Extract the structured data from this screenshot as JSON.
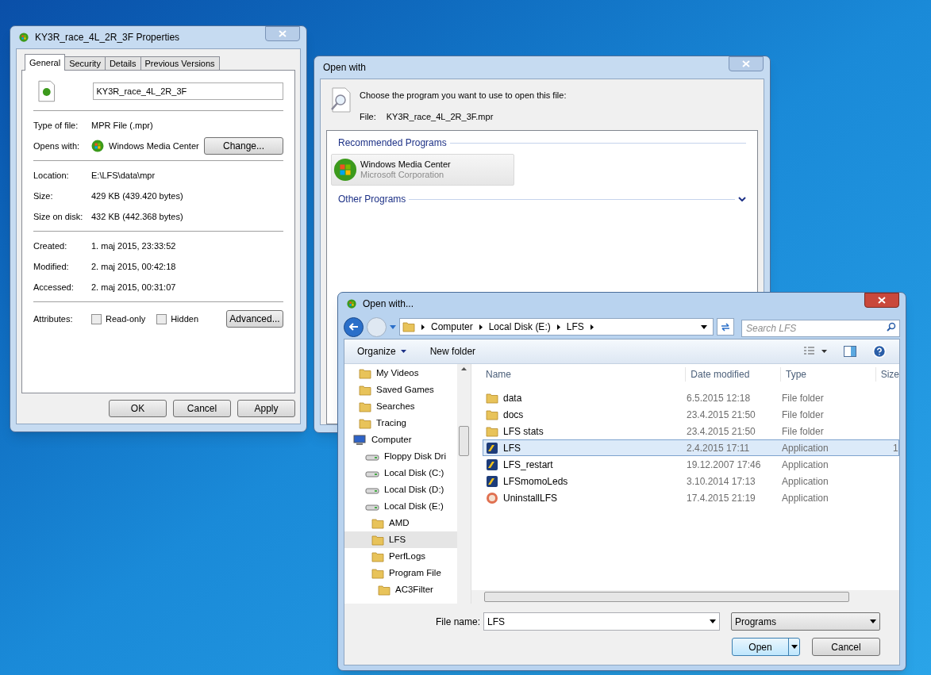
{
  "properties": {
    "title": "KY3R_race_4L_2R_3F Properties",
    "active": false,
    "tabs": [
      {
        "label": "General",
        "selected": true
      },
      {
        "label": "Security",
        "selected": false
      },
      {
        "label": "Details",
        "selected": false
      },
      {
        "label": "Previous Versions",
        "selected": false
      }
    ],
    "file_name": "KY3R_race_4L_2R_3F",
    "sections": [
      [
        {
          "label": "Type of file:",
          "value": "MPR File (.mpr)",
          "kind": "text"
        },
        {
          "label": "Opens with:",
          "value": "Windows Media Center",
          "kind": "program",
          "button": "Change..."
        }
      ],
      [
        {
          "label": "Location:",
          "value": "E:\\LFS\\data\\mpr",
          "kind": "text"
        },
        {
          "label": "Size:",
          "value": "429 KB (439.420 bytes)",
          "kind": "text"
        },
        {
          "label": "Size on disk:",
          "value": "432 KB (442.368 bytes)",
          "kind": "text"
        }
      ],
      [
        {
          "label": "Created:",
          "value": "1. maj 2015, 23:33:52",
          "kind": "text"
        },
        {
          "label": "Modified:",
          "value": "2. maj 2015, 00:42:18",
          "kind": "text"
        },
        {
          "label": "Accessed:",
          "value": "2. maj 2015, 00:31:07",
          "kind": "text"
        }
      ]
    ],
    "attributes": {
      "label": "Attributes:",
      "checkboxes": [
        {
          "label": "Read-only",
          "checked": false
        },
        {
          "label": "Hidden",
          "checked": false
        }
      ],
      "button": "Advanced..."
    },
    "buttons": [
      "OK",
      "Cancel",
      "Apply"
    ]
  },
  "open_with": {
    "title": "Open with",
    "active": false,
    "prompt": "Choose the program you want to use to open this file:",
    "file_label": "File:",
    "file_value": "KY3R_race_4L_2R_3F.mpr",
    "recommended_heading": "Recommended Programs",
    "programs": [
      {
        "name": "Windows Media Center",
        "publisher": "Microsoft Corporation"
      }
    ],
    "other_heading": "Other Programs"
  },
  "open_dialog": {
    "title": "Open with...",
    "active": true,
    "breadcrumb": [
      "Computer",
      "Local Disk (E:)",
      "LFS"
    ],
    "search_placeholder": "Search LFS",
    "toolbar": {
      "organize": "Organize",
      "new_folder": "New folder"
    },
    "tree": [
      {
        "label": "My Videos",
        "kind": "folder",
        "selected": false
      },
      {
        "label": "Saved Games",
        "kind": "folder",
        "selected": false
      },
      {
        "label": "Searches",
        "kind": "folder",
        "selected": false
      },
      {
        "label": "Tracing",
        "kind": "folder",
        "selected": false
      },
      {
        "label": "Computer",
        "kind": "computer",
        "selected": false,
        "children": [
          {
            "label": "Floppy Disk Dri",
            "kind": "drive",
            "selected": false
          },
          {
            "label": "Local Disk (C:)",
            "kind": "drive",
            "selected": false
          },
          {
            "label": "Local Disk (D:)",
            "kind": "drive",
            "selected": false
          },
          {
            "label": "Local Disk (E:)",
            "kind": "drive",
            "selected": false,
            "children": [
              {
                "label": "AMD",
                "kind": "folder",
                "selected": false
              },
              {
                "label": "LFS",
                "kind": "folder",
                "selected": true
              },
              {
                "label": "PerfLogs",
                "kind": "folder",
                "selected": false
              },
              {
                "label": "Program File",
                "kind": "folder",
                "selected": false,
                "children": [
                  {
                    "label": "AC3Filter",
                    "kind": "folder",
                    "selected": false
                  }
                ]
              }
            ]
          }
        ]
      }
    ],
    "columns": [
      "Name",
      "Date modified",
      "Type",
      "Size"
    ],
    "rows": [
      {
        "name": "data",
        "date": "6.5.2015 12:18",
        "type": "File folder",
        "kind": "folder",
        "selected": false
      },
      {
        "name": "docs",
        "date": "23.4.2015 21:50",
        "type": "File folder",
        "kind": "folder",
        "selected": false
      },
      {
        "name": "LFS stats",
        "date": "23.4.2015 21:50",
        "type": "File folder",
        "kind": "folder",
        "selected": false
      },
      {
        "name": "LFS",
        "date": "2.4.2015 17:11",
        "type": "Application",
        "size": "1",
        "kind": "app",
        "selected": true
      },
      {
        "name": "LFS_restart",
        "date": "19.12.2007 17:46",
        "type": "Application",
        "kind": "app",
        "selected": false
      },
      {
        "name": "LFSmomoLeds",
        "date": "3.10.2014 17:13",
        "type": "Application",
        "kind": "app",
        "selected": false
      },
      {
        "name": "UninstallLFS",
        "date": "17.4.2015 21:19",
        "type": "Application",
        "kind": "uninstall",
        "selected": false
      }
    ],
    "file_name_label": "File name:",
    "file_name_value": "LFS",
    "filter": "Programs",
    "buttons": [
      "Open",
      "Cancel"
    ]
  }
}
